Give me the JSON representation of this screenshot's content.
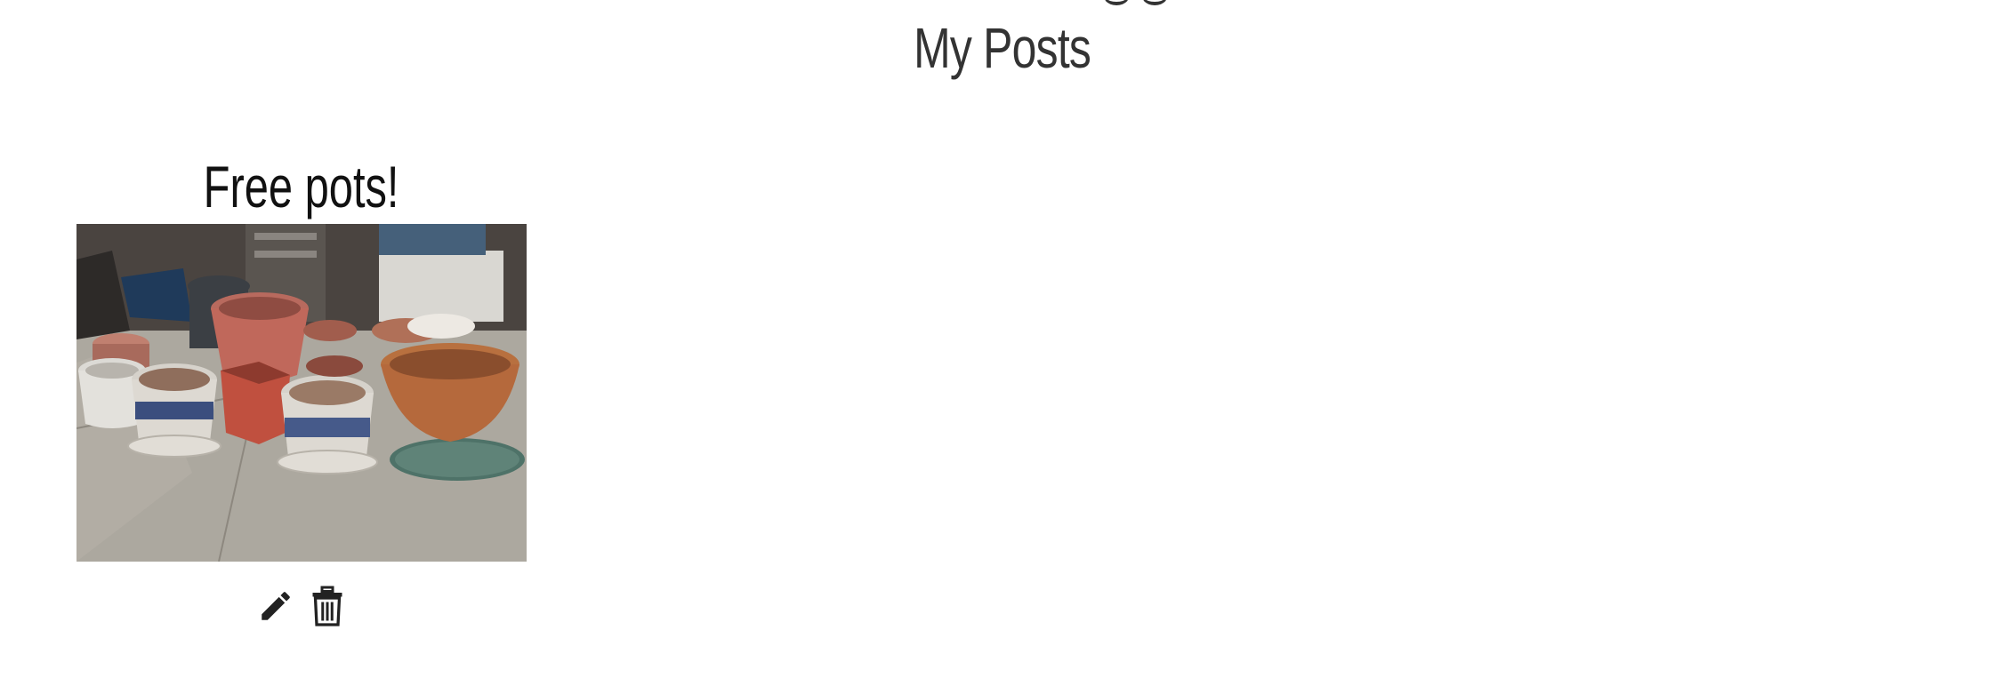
{
  "header": {
    "title": "My Posts"
  },
  "posts": [
    {
      "title": "Free pots!",
      "image_alt": "Assorted flower pots",
      "actions": {
        "edit_icon": "pencil-icon",
        "delete_icon": "trash-icon"
      }
    }
  ],
  "colors": {
    "title": "#333333",
    "post_title": "#111111",
    "icon": "#222222"
  }
}
